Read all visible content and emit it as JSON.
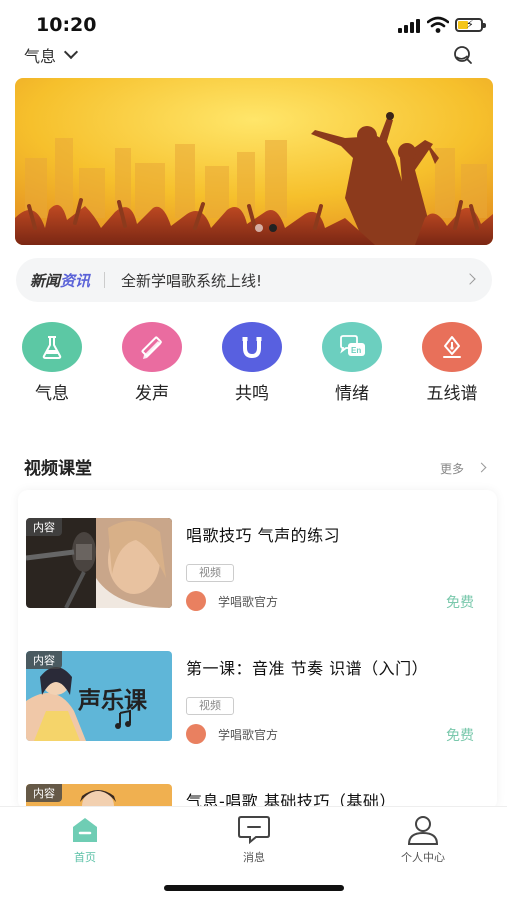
{
  "status": {
    "time": "10:20"
  },
  "header": {
    "category": "气息"
  },
  "news": {
    "badge_a": "新闻",
    "badge_b": "资讯",
    "text": "全新学唱歌系统上线!"
  },
  "categories": [
    {
      "label": "气息",
      "icon": "flask-icon",
      "color": "#5cc8a4"
    },
    {
      "label": "发声",
      "icon": "ruler-pencil-icon",
      "color": "#ea6ca0"
    },
    {
      "label": "共鸣",
      "icon": "magnet-icon",
      "color": "#5860e0"
    },
    {
      "label": "情绪",
      "icon": "chat-en-icon",
      "color": "#6ccfbf"
    },
    {
      "label": "五线谱",
      "icon": "pen-nib-icon",
      "color": "#e8705a"
    }
  ],
  "video_section": {
    "title": "视频课堂",
    "more": "更多"
  },
  "courses": [
    {
      "tag": "内容",
      "title": "唱歌技巧 气声的练习",
      "type": "视频",
      "publisher": "学唱歌官方",
      "price": "免费"
    },
    {
      "tag": "内容",
      "title": "第一课：音准 节奏 识谱（入门）",
      "type": "视频",
      "publisher": "学唱歌官方",
      "price": "免费",
      "thumb_text": "声乐课"
    },
    {
      "tag": "内容",
      "title": "气息-唱歌 基础技巧（基础）"
    }
  ],
  "nav": [
    {
      "label": "首页",
      "icon": "home-icon"
    },
    {
      "label": "消息",
      "icon": "message-icon"
    },
    {
      "label": "个人中心",
      "icon": "user-icon"
    }
  ],
  "banner": {
    "slide_count": 2,
    "active_slide": 2
  },
  "theme": {
    "accent": "#5ec2a8",
    "price_color": "#7ac8ac",
    "news_accent": "#5b63d8"
  }
}
